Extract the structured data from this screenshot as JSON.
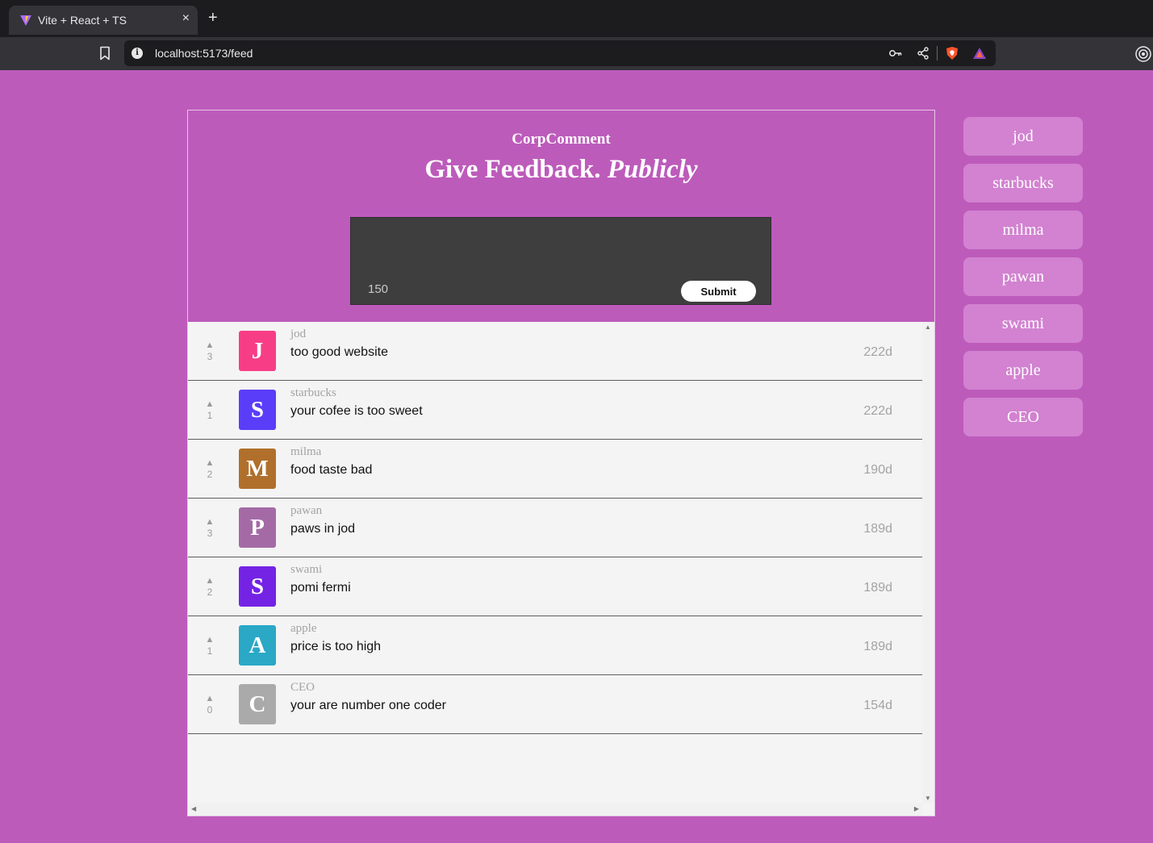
{
  "browser": {
    "tab_title": "Vite + React + TS",
    "tab_close": "×",
    "new_tab": "+",
    "url": "localhost:5173/feed"
  },
  "header": {
    "logo": "CorpComment",
    "heading_main": "Give Feedback.",
    "heading_em": "Publicly"
  },
  "form": {
    "textarea_value": "",
    "char_count": "150",
    "submit_label": "Submit"
  },
  "feedback_items": [
    {
      "upvotes": "3",
      "badge_letter": "J",
      "badge_color": "#f83d87",
      "company": "jod",
      "text": "too good website",
      "days_ago": "222d"
    },
    {
      "upvotes": "1",
      "badge_letter": "S",
      "badge_color": "#5a3df8",
      "company": "starbucks",
      "text": "your cofee is too sweet",
      "days_ago": "222d"
    },
    {
      "upvotes": "2",
      "badge_letter": "M",
      "badge_color": "#b0702c",
      "company": "milma",
      "text": "food taste bad",
      "days_ago": "190d"
    },
    {
      "upvotes": "3",
      "badge_letter": "P",
      "badge_color": "#a46aa6",
      "company": "pawan",
      "text": "paws in jod",
      "days_ago": "189d"
    },
    {
      "upvotes": "2",
      "badge_letter": "S",
      "badge_color": "#7423e5",
      "company": "swami",
      "text": "pomi fermi",
      "days_ago": "189d"
    },
    {
      "upvotes": "1",
      "badge_letter": "A",
      "badge_color": "#2aa8c6",
      "company": "apple",
      "text": "price is too high",
      "days_ago": "189d"
    },
    {
      "upvotes": "0",
      "badge_letter": "C",
      "badge_color": "#aaaaaa",
      "company": "CEO",
      "text": "your are number one coder",
      "days_ago": "154d"
    }
  ],
  "hashtags": [
    "jod",
    "starbucks",
    "milma",
    "pawan",
    "swami",
    "apple",
    "CEO"
  ],
  "colors": {
    "background": "#bd5bbb",
    "hashtag_button": "#d282d0",
    "form_bg": "#3f3e3f",
    "feed_bg": "#f4f4f4"
  }
}
